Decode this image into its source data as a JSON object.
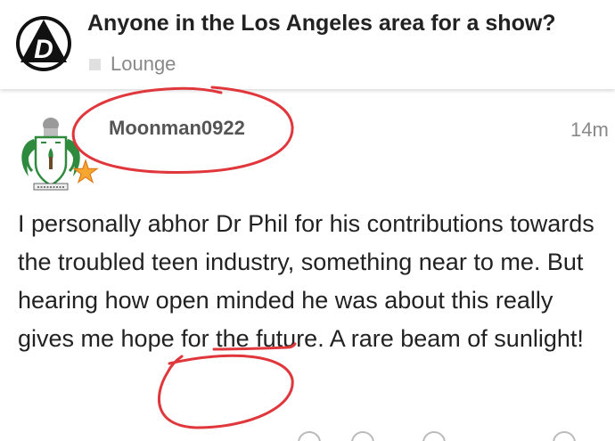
{
  "header": {
    "title": "Anyone in the Los Angeles area for a show?",
    "category": "Lounge",
    "logo_icon": "d-triangle-logo-icon"
  },
  "post": {
    "username": "Moonman0922",
    "time": "14m",
    "avatar_icon": "coat-of-arms-avatar-icon",
    "badge_icon": "star-icon",
    "body": "I personally abhor Dr Phil for his contributions towards the troubled teen industry, something near to me. But hearing how open minded he was about this really gives me hope for the future. A rare beam of sunlight!"
  },
  "actions": [
    "like-icon",
    "heart-icon",
    "share-icon",
    "more-icon"
  ],
  "colors": {
    "annotation": "#e0373c",
    "title": "#222222",
    "muted": "#888888",
    "username": "#555555",
    "category_square": "#e0e0e0",
    "star": "#f7a632"
  }
}
